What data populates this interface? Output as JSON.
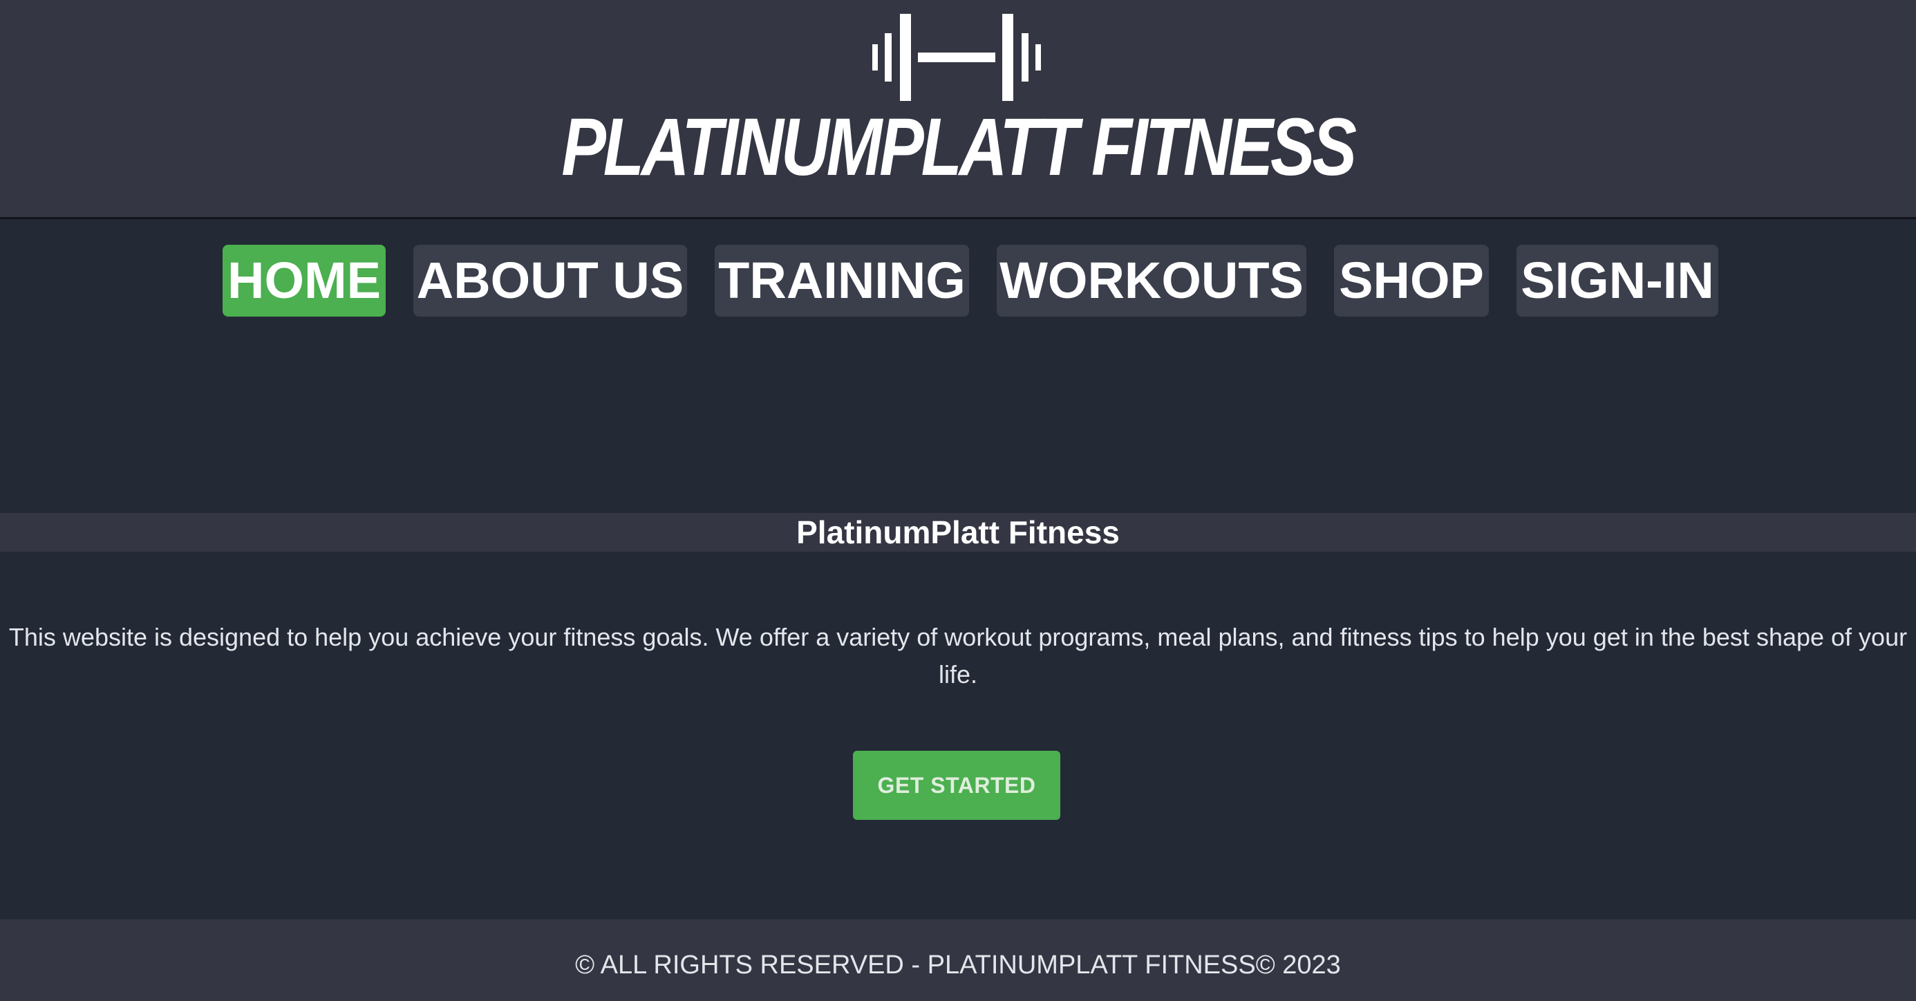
{
  "brand": {
    "logo_icon": "barbell-icon",
    "logo_text": "PLATINUMPLATT FITNESS"
  },
  "nav": {
    "items": [
      {
        "label": "HOME",
        "active": true
      },
      {
        "label": "ABOUT US",
        "active": false
      },
      {
        "label": "TRAINING",
        "active": false
      },
      {
        "label": "WORKOUTS",
        "active": false
      },
      {
        "label": "SHOP",
        "active": false
      },
      {
        "label": "SIGN-IN",
        "active": false
      }
    ]
  },
  "hero": {
    "title": "PlatinumPlatt Fitness",
    "description": "This website is designed to help you achieve your fitness goals. We offer a variety of workout programs, meal plans, and fitness tips to help you get in the best shape of your life.",
    "cta_label": "GET STARTED"
  },
  "footer": {
    "text": "© ALL RIGHTS RESERVED - PLATINUMPLATT FITNESS© 2023"
  },
  "colors": {
    "header_bg": "#343643",
    "page_bg": "#232935",
    "nav_item_bg": "#3b3e4b",
    "accent": "#4caf50",
    "text": "#ffffff"
  }
}
